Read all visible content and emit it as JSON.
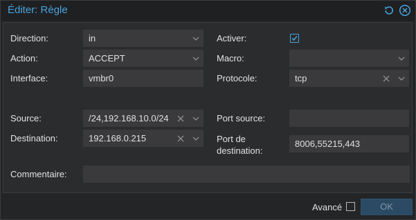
{
  "dialog": {
    "title": "Éditer: Règle",
    "tools": {
      "refresh_icon": "refresh-icon",
      "close_icon": "close-circle-icon"
    }
  },
  "colors": {
    "accent": "#4aa3df",
    "panel": "#2b2c2e",
    "field": "#3a3a3c"
  },
  "form": {
    "direction": {
      "label": "Direction:",
      "value": "in"
    },
    "action": {
      "label": "Action:",
      "value": "ACCEPT"
    },
    "interface": {
      "label": "Interface:",
      "value": "vmbr0"
    },
    "source": {
      "label": "Source:",
      "value": "/24,192.168.10.0/24"
    },
    "destination": {
      "label": "Destination:",
      "value": "192.168.0.215"
    },
    "comment": {
      "label": "Commentaire:",
      "value": ""
    },
    "enable": {
      "label": "Activer:",
      "checked": true
    },
    "macro": {
      "label": "Macro:",
      "value": ""
    },
    "protocol": {
      "label": "Protocole:",
      "value": "tcp"
    },
    "source_port": {
      "label": "Port source:",
      "value": ""
    },
    "dest_port": {
      "label_line1": "Port de",
      "label_line2": "destination:",
      "value": "8006,55215,443"
    }
  },
  "footer": {
    "advanced_label": "Avancé",
    "advanced_checked": false,
    "ok_label": "OK"
  }
}
